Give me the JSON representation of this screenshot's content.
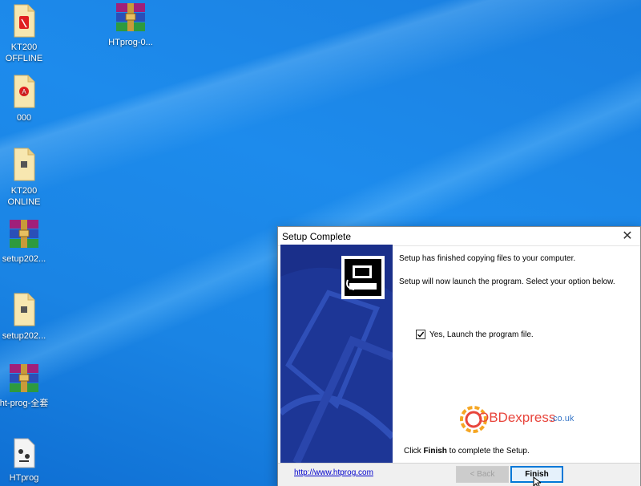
{
  "desktop": {
    "icons": [
      {
        "label": "KT200 OFFLINE",
        "icon": "pdf-icon"
      },
      {
        "label": "HTprog-0...",
        "icon": "winrar-archive-icon"
      },
      {
        "label": "000",
        "icon": "pdf-icon"
      },
      {
        "label": "KT200 ONLINE",
        "icon": "document-icon"
      },
      {
        "label": "setup202...",
        "icon": "winrar-archive-icon"
      },
      {
        "label": "setup202...",
        "icon": "document-icon"
      },
      {
        "label": "ht-prog-全套",
        "icon": "winrar-archive-icon"
      },
      {
        "label": "HTprog",
        "icon": "app-file-icon"
      }
    ]
  },
  "dialog": {
    "title": "Setup Complete",
    "close_glyph": "✕",
    "message_1": "Setup has finished copying files to your computer.",
    "message_2": "Setup will now launch the program. Select your option below.",
    "checkbox": {
      "label": "Yes, Launch the program file.",
      "checked": true
    },
    "watermark": {
      "brand": "OBDexpress",
      "suffix": ".co.uk"
    },
    "finish_prefix": "Click ",
    "finish_bold": "Finish",
    "finish_suffix": " to complete the Setup.",
    "link": "http://www.htprog.com",
    "back_button": "< Back",
    "finish_button": "Finish"
  },
  "colors": {
    "desktop": "#1684e6",
    "side_panel": "#1a2f8a",
    "accent": "#0078d7"
  }
}
